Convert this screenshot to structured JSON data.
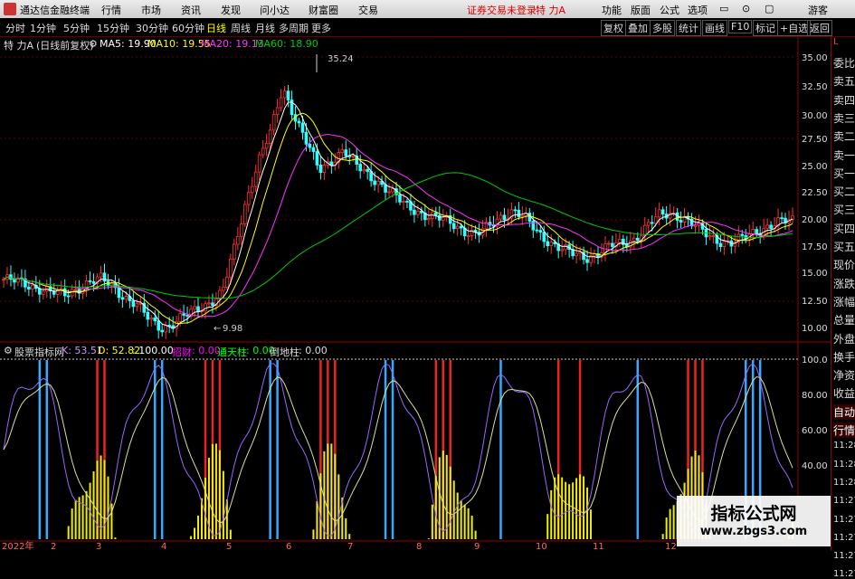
{
  "app": {
    "title": "通达信金融终端",
    "status": "证券交易未登录",
    "stock_tag": "特 力A"
  },
  "menu": {
    "items": [
      "行情",
      "市场",
      "资讯",
      "发现",
      "问小达",
      "财富圈",
      "交易"
    ],
    "right": [
      "功能",
      "版面",
      "公式",
      "选项"
    ],
    "user": "游客"
  },
  "periods": {
    "items": [
      "分时",
      "1分钟",
      "5分钟",
      "15分钟",
      "30分钟",
      "60分钟",
      "日线",
      "周线",
      "月线",
      "多周期",
      "更多"
    ],
    "active": "日线"
  },
  "toolbar": {
    "buttons": [
      "复权",
      "叠加",
      "多股",
      "统计",
      "画线",
      "F10",
      "标记",
      "+自选",
      "返回"
    ]
  },
  "info": {
    "name": "特 力A",
    "mode": "(日线前复权)",
    "ma5": "MA5: 19.90",
    "ma10": "MA10: 19.55",
    "ma20": "MA20: 19.13",
    "ma60": "MA60: 18.90"
  },
  "price_axis": {
    "ticks": [
      "35.00",
      "32.50",
      "30.00",
      "27.50",
      "25.00",
      "22.50",
      "20.00",
      "17.50",
      "15.00",
      "12.50",
      "10.00"
    ],
    "high_label": "35.24",
    "low_label": "9.98"
  },
  "indicator": {
    "name": "股票指标网",
    "k": "K: 53.51",
    "d": "D: 52.82",
    "v100": ": 100.00",
    "zhao": "招财",
    "zhao_val": ": 0.00",
    "tong": "通天柱",
    "tong_val": ": 0.00",
    "tian": "倒地柱",
    "tian_val": ": 0.00",
    "ticks": [
      "100.0",
      "80.00",
      "60.00",
      "40.00"
    ]
  },
  "time_axis": {
    "labels": [
      "2022年",
      "2",
      "3",
      "4",
      "5",
      "6",
      "7",
      "8",
      "9",
      "10",
      "11",
      "12"
    ]
  },
  "side_panel": {
    "items": [
      "委比",
      "卖五",
      "卖四",
      "卖三",
      "卖二",
      "卖一",
      "买一",
      "买二",
      "买三",
      "买四",
      "买五",
      "现价",
      "涨跌",
      "涨幅",
      "总量",
      "外盘",
      "换手",
      "净资",
      "收益",
      "自动",
      "行情",
      "11:28",
      "11:28",
      "11:28",
      "11:27",
      "11:27",
      "11:27",
      "11:27",
      "11:27"
    ]
  },
  "colors": {
    "up": "#ff3333",
    "down": "#33ffff",
    "ma5": "#ffffff",
    "ma10": "#ffff00",
    "ma20": "#ff33ff",
    "ma60": "#00cc00"
  },
  "watermark": {
    "line1": "指标公式网",
    "line2": "www.zbgs3.com"
  },
  "chart_data": {
    "type": "candlestick",
    "ylim": [
      9.5,
      36
    ],
    "high": 35.24,
    "low": 9.98,
    "ma5_end": 19.9,
    "ma10_end": 19.55,
    "ma20_end": 19.13,
    "ma60_end": 18.9,
    "close_path": [
      14.8,
      14.6,
      14.3,
      14.0,
      13.6,
      13.4,
      14.0,
      14.5,
      14.8,
      14.2,
      13.2,
      12.4,
      11.2,
      10.5,
      10.8,
      11.5,
      12.2,
      12.8,
      13.5,
      17.5,
      22.0,
      25.5,
      28.0,
      32.0,
      29.5,
      27.0,
      24.5,
      25.5,
      26.5,
      25.0,
      24.2,
      23.5,
      22.5,
      21.5,
      21.0,
      20.5,
      20.2,
      19.8,
      19.2,
      18.8,
      19.5,
      20.5,
      21.0,
      20.2,
      19.0,
      18.2,
      17.5,
      17.0,
      16.8,
      17.2,
      17.8,
      18.0,
      18.5,
      19.5,
      20.5,
      20.8,
      20.3,
      19.5,
      18.8,
      18.3,
      18.0,
      18.5,
      19.2,
      19.6,
      19.9,
      20.1
    ]
  }
}
